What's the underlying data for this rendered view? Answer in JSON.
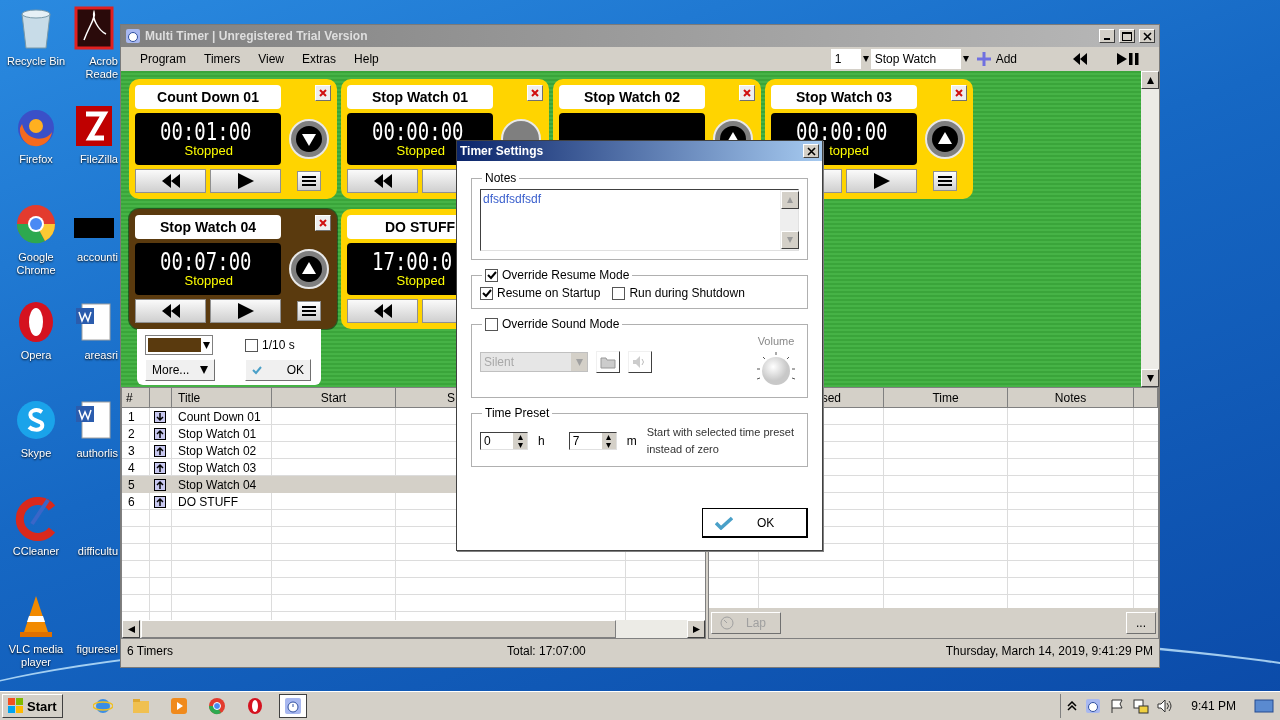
{
  "desktop_icons": [
    {
      "label": "Recycle Bin",
      "kind": "recycle"
    },
    {
      "label": "Firefox",
      "kind": "firefox"
    },
    {
      "label": "Google Chrome",
      "kind": "chrome"
    },
    {
      "label": "Opera",
      "kind": "opera"
    },
    {
      "label": "Skype",
      "kind": "skype"
    },
    {
      "label": "CCleaner",
      "kind": "ccleaner"
    },
    {
      "label": "VLC media player",
      "kind": "vlc"
    }
  ],
  "desktop_icons_2": [
    {
      "label": "Acrob\nReade",
      "kind": "pdf"
    },
    {
      "label": "FileZilla",
      "kind": "filezilla"
    },
    {
      "label": "accounti",
      "kind": "dark"
    },
    {
      "label": "areasri",
      "kind": "word"
    },
    {
      "label": "authorlis",
      "kind": "word"
    },
    {
      "label": "difficultu",
      "kind": "blank"
    },
    {
      "label": "figuresel",
      "kind": "blank"
    }
  ],
  "window": {
    "title": "Multi Timer | Unregistered Trial Version"
  },
  "menu": [
    "Program",
    "Timers",
    "View",
    "Extras",
    "Help"
  ],
  "toolbar": {
    "count": "1",
    "timer_type": "Stop Watch",
    "add": "Add"
  },
  "timers": [
    {
      "title": "Count Down 01",
      "kind": "countdown",
      "time": "00:01:00",
      "status": "Stopped",
      "color": "#ffd400",
      "selected": false
    },
    {
      "title": "Stop Watch 01",
      "kind": "stopwatch",
      "time": "00:00:00",
      "status": "Stopped",
      "color": "#ffd400",
      "selected": false
    },
    {
      "title": "Stop Watch 02",
      "kind": "stopwatch",
      "color": "#ffd400",
      "selected": false
    },
    {
      "title": "Stop Watch 03",
      "kind": "stopwatch",
      "time": "00:00:00",
      "status": "topped",
      "color": "#ffd400",
      "selected": false
    },
    {
      "title": "Stop Watch 04",
      "kind": "stopwatch",
      "time": "00:07:00",
      "status": "Stopped",
      "color": "#5a3a0e",
      "selected": true
    },
    {
      "title": "DO STUFF",
      "kind": "stopwatch",
      "time": "17:00:0",
      "status": "Stopped",
      "color": "#ffd400",
      "selected": false
    }
  ],
  "card_options": {
    "tenths_label": "1/10 s",
    "tenths": false,
    "more": "More...",
    "ok": "OK"
  },
  "timer_list": {
    "columns": [
      "#",
      "Title",
      "Start",
      "S"
    ],
    "rows": [
      {
        "number": "1",
        "kind": "countdown",
        "title": "Count Down 01",
        "selected": false
      },
      {
        "number": "2",
        "kind": "stopwatch",
        "title": "Stop Watch 01",
        "selected": false
      },
      {
        "number": "3",
        "kind": "stopwatch",
        "title": "Stop Watch 02",
        "selected": false
      },
      {
        "number": "4",
        "kind": "stopwatch",
        "title": "Stop Watch 03",
        "selected": false
      },
      {
        "number": "5",
        "kind": "stopwatch",
        "title": "Stop Watch 04",
        "selected": true
      },
      {
        "number": "6",
        "kind": "stopwatch",
        "title": "DO STUFF",
        "selected": false
      }
    ]
  },
  "lap_list": {
    "columns": [
      "sed",
      "Time",
      "Notes"
    ],
    "lap": "Lap",
    "lap_disabled": true,
    "more": "..."
  },
  "status_bar": {
    "count": "6 Timers",
    "total": "Total: 17:07:00",
    "datetime": "Thursday, March 14, 2019, 9:41:29 PM"
  },
  "dialog": {
    "title": "Timer Settings",
    "notes_label": "Notes",
    "notes": "dfsdfsdfsdf",
    "override_resume": {
      "label": "Override Resume Mode",
      "checked": true
    },
    "resume_startup": {
      "label": "Resume on Startup",
      "checked": true
    },
    "run_shutdown": {
      "label": "Run during Shutdown",
      "checked": false
    },
    "override_sound": {
      "label": "Override Sound Mode",
      "checked": false
    },
    "sound": "Silent",
    "volume_label": "Volume",
    "preset_label": "Time Preset",
    "hours": "0",
    "hours_unit": "h",
    "minutes": "7",
    "minutes_unit": "m",
    "preset_hint": "Start with selected time preset instead of zero",
    "ok": "OK"
  },
  "taskbar": {
    "start": "Start",
    "apps": [
      {
        "kind": "ie",
        "selected": false
      },
      {
        "kind": "folder",
        "selected": false
      },
      {
        "kind": "media",
        "selected": false
      },
      {
        "kind": "chrome",
        "selected": false
      },
      {
        "kind": "opera",
        "selected": false
      },
      {
        "kind": "timer",
        "selected": true
      }
    ],
    "clock": "9:41 PM"
  }
}
